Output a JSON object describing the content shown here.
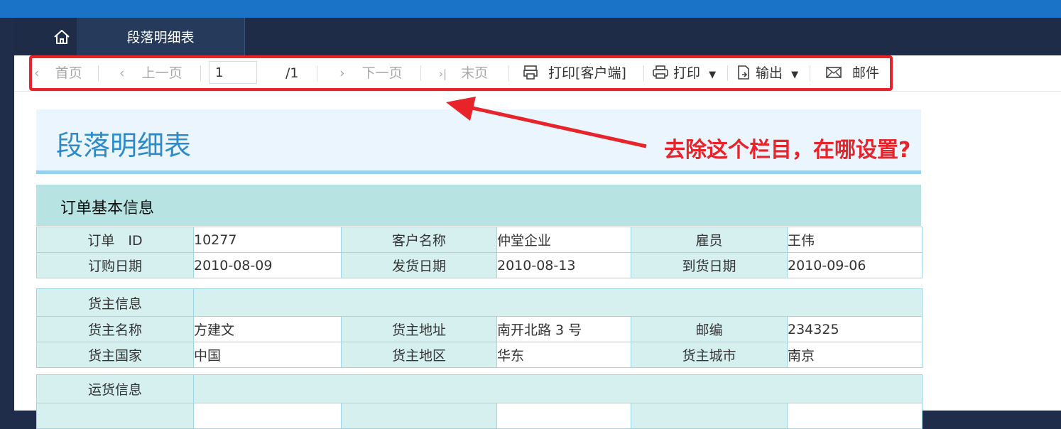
{
  "tabs": {
    "doc_tab_label": "段落明细表"
  },
  "toolbar": {
    "first": "首页",
    "prev": "上一页",
    "page_value": "1",
    "page_total": "/1",
    "next": "下一页",
    "last": "末页",
    "print_client": "打印[客户端]",
    "print": "打印",
    "export": "输出",
    "email": "邮件"
  },
  "annotation": {
    "text": "去除这个栏目，在哪设置?"
  },
  "report": {
    "title": "段落明细表",
    "section_title": "订单基本信息",
    "order_rows": [
      [
        "订单　ID",
        "10277",
        "客户名称",
        "仲堂企业",
        "雇员",
        "王伟"
      ],
      [
        "订购日期",
        "2010-08-09",
        "发货日期",
        "2010-08-13",
        "到货日期",
        "2010-09-06"
      ]
    ],
    "shipper_header": "货主信息",
    "shipper_rows": [
      [
        "货主名称",
        "方建文",
        "货主地址",
        "南开北路 3 号",
        "邮编",
        "234325"
      ],
      [
        "货主国家",
        "中国",
        "货主地区",
        "华东",
        "货主城市",
        "南京"
      ]
    ],
    "shipping_header": "运货信息"
  },
  "colors": {
    "topbar": "#1a73c6",
    "nav": "#1e2c47",
    "annotation": "#e8232a",
    "title": "#2e8bc9",
    "section": "#b7e3e3"
  },
  "icons": [
    "home-icon",
    "chevron-left-icon",
    "chevron-right-icon",
    "client-printer-icon",
    "printer-icon",
    "export-icon",
    "mail-icon"
  ]
}
